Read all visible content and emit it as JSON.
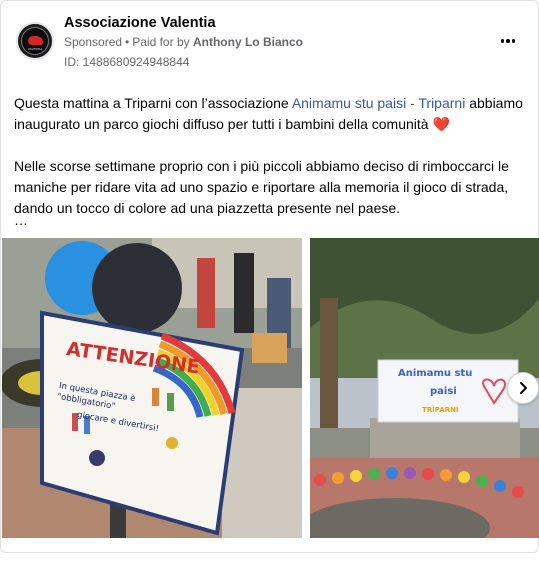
{
  "post": {
    "page_name": "Associazione Valentia",
    "sponsored_label": "Sponsored",
    "separator": "•",
    "paid_for_label": "Paid for by",
    "payer_name": "Anthony Lo Bianco",
    "ad_id": "ID: 1488680924948844",
    "avatar_text": "VALENTIA",
    "text": {
      "p1_part1": "Questa mattina a Triparni con l’associazione ",
      "p1_link": "Animamu stu paisi - Triparni",
      "p1_part2": " abbiamo inaugurato un parco giochi diffuso per tutti i bambini della comunità ",
      "heart": "❤️",
      "p2": "Nelle scorse settimane proprio con i più piccoli abbiamo deciso di rimboccarci le maniche per ridare vita ad uno spazio e riportare alla memoria il gioco di strada, dando un tocco di colore ad una piazzetta presente nel paese.",
      "truncation": "…"
    }
  },
  "media": {
    "image1": {
      "sign_title": "ATTENZIONE",
      "sign_line1": "In questa piazza è \"obbligatorio\"",
      "sign_line2": "giocare e divertirsi!"
    },
    "image2": {
      "banner_line1": "Animamu  stu",
      "banner_line2": "paisi",
      "banner_line3": "TRIPARNI"
    },
    "next_icon": "chevron-right-icon"
  },
  "colors": {
    "link": "#385898",
    "meta": "#65676b",
    "heart": "#e0243a"
  }
}
